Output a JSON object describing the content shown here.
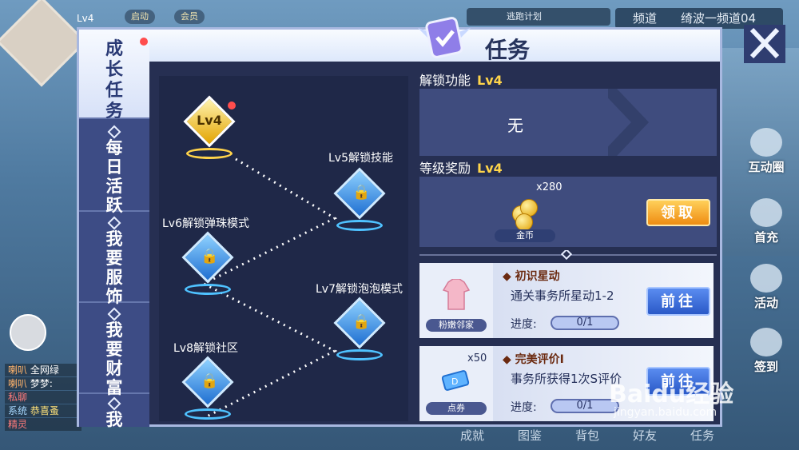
{
  "hud": {
    "level_tag": "Lv4",
    "pill_1": "启动",
    "pill_2": "会员",
    "music_text": "逃跑计划",
    "channel_label": "频道",
    "channel_value": "绮波一频道04"
  },
  "right_menu": [
    {
      "label": "互动圈",
      "icon": "interaction-icon"
    },
    {
      "label": "首充",
      "icon": "first-recharge-icon"
    },
    {
      "label": "活动",
      "icon": "event-icon"
    },
    {
      "label": "签到",
      "icon": "checkin-icon"
    }
  ],
  "bottom_nav": [
    "成就",
    "图鉴",
    "背包",
    "好友",
    "任务"
  ],
  "chat": [
    {
      "tag": "喇叭",
      "text": "全网绿"
    },
    {
      "tag": "喇叭",
      "text": "梦梦:"
    },
    {
      "tag": "私聊",
      "text": ""
    },
    {
      "tag": "系统",
      "text": "恭喜蚤"
    },
    {
      "tag": "精灵",
      "text": ""
    }
  ],
  "dialog": {
    "title": "任务",
    "tabs": [
      {
        "label": "成长任务",
        "active": true
      },
      {
        "label": "每日活跃",
        "active": false
      },
      {
        "label": "我要服饰",
        "active": false
      },
      {
        "label": "我要财富",
        "active": false
      },
      {
        "label": "我",
        "active": false
      }
    ],
    "tree": {
      "current": "Lv4",
      "nodes": [
        {
          "label": "Lv5解锁技能"
        },
        {
          "label": "Lv6解锁弹珠模式"
        },
        {
          "label": "Lv7解锁泡泡模式"
        },
        {
          "label": "Lv8解锁社区"
        }
      ]
    },
    "unlock": {
      "title": "解锁功能",
      "level": "Lv4",
      "value": "无"
    },
    "reward": {
      "title": "等级奖励",
      "level": "Lv4",
      "quantity": "x280",
      "item": "金币",
      "button": "领取"
    },
    "tasks": [
      {
        "name": "初识星动",
        "desc": "通关事务所星动1-2",
        "item": "粉嫩邻家",
        "quantity": "",
        "progress_label": "进度:",
        "progress": "0/1",
        "button": "前往"
      },
      {
        "name": "完美评价I",
        "desc": "事务所获得1次S评价",
        "item": "点券",
        "quantity": "x50",
        "progress_label": "进度:",
        "progress": "0/1",
        "button": "前往"
      }
    ]
  },
  "watermark": {
    "brand": "Baidu经验",
    "url": "jingyan.baidu.com"
  }
}
